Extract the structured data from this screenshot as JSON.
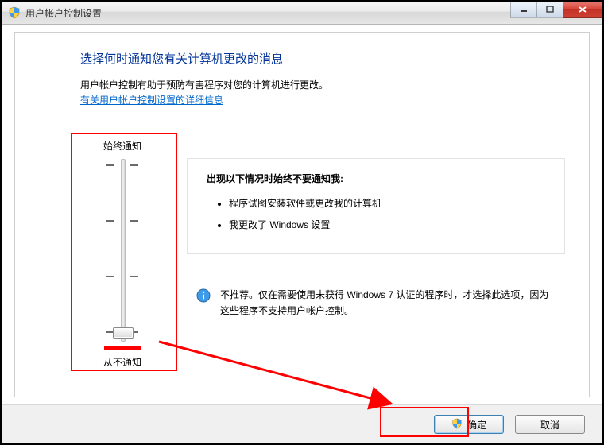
{
  "window": {
    "title": "用户帐户控制设置"
  },
  "page": {
    "heading": "选择何时通知您有关计算机更改的消息",
    "subtext": "用户帐户控制有助于预防有害程序对您的计算机进行更改。",
    "link": "有关用户帐户控制设置的详细信息"
  },
  "slider": {
    "top_label": "始终通知",
    "bottom_label": "从不通知"
  },
  "description": {
    "title": "出现以下情况时始终不要通知我:",
    "bullets": [
      "程序试图安装软件或更改我的计算机",
      "我更改了 Windows 设置"
    ]
  },
  "info": {
    "text": "不推荐。仅在需要使用未获得 Windows 7 认证的程序时，才选择此选项，因为这些程序不支持用户帐户控制。"
  },
  "buttons": {
    "ok": "确定",
    "cancel": "取消"
  }
}
